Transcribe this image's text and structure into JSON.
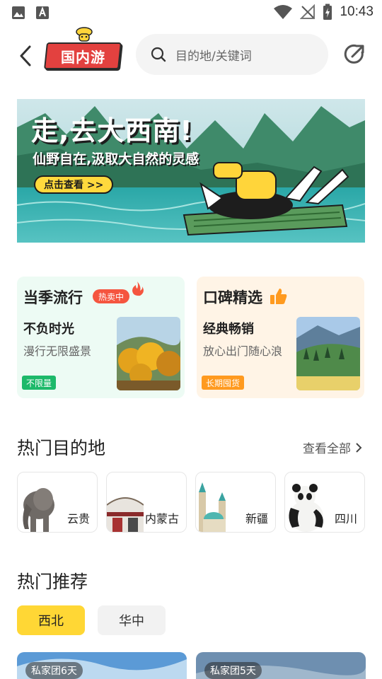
{
  "status_bar": {
    "time": "10:43",
    "left_icons": [
      "gallery-icon",
      "font-icon"
    ],
    "right_icons": [
      "wifi-icon",
      "no-signal-icon",
      "battery-charging-icon"
    ]
  },
  "header": {
    "brand": "国内游",
    "search_placeholder": "目的地/关键词",
    "icons": [
      "back-icon",
      "search-icon",
      "share-icon"
    ]
  },
  "banner": {
    "title": "走,去大西南!",
    "subtitle": "仙野自在,汲取大自然的灵感",
    "cta": "点击查看 >>"
  },
  "features": [
    {
      "title": "当季流行",
      "badge": "热卖中",
      "tagline": "不负时光",
      "desc": "漫行无限盛景",
      "tag": "不限量"
    },
    {
      "title": "口碑精选",
      "tagline": "经典畅销",
      "desc": "放心出门随心浪",
      "tag": "长期囤货"
    }
  ],
  "hot_destinations": {
    "title": "热门目的地",
    "view_all": "查看全部",
    "items": [
      {
        "name": "云贵"
      },
      {
        "name": "内蒙古"
      },
      {
        "name": "新疆"
      },
      {
        "name": "四川"
      }
    ]
  },
  "recommend": {
    "title": "热门推荐",
    "tabs": [
      {
        "label": "西北",
        "active": true
      },
      {
        "label": "华中",
        "active": false
      }
    ],
    "products": [
      {
        "badge": "私家团6天"
      },
      {
        "badge": "私家团5天"
      }
    ]
  },
  "colors": {
    "brand_red": "#e3413f",
    "accent_yellow": "#ffd735",
    "hot_red": "#f5553f",
    "tag_green": "#1db96a",
    "tag_orange": "#ff9a1f"
  }
}
